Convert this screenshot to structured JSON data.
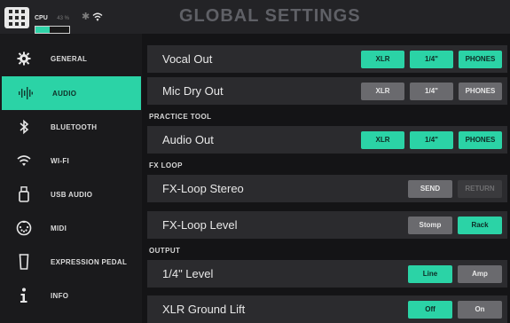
{
  "header": {
    "title": "GLOBAL SETTINGS",
    "cpu_label": "CPU",
    "cpu_percent_text": "43 %",
    "cpu_load": 0.43,
    "bluetooth_glyph": "✱",
    "icons": [
      "apps-grid-icon",
      "bluetooth-icon",
      "wifi-icon"
    ]
  },
  "sidebar": {
    "items": [
      {
        "label": "GENERAL",
        "icon": "gear-icon"
      },
      {
        "label": "AUDIO",
        "icon": "waveform-icon",
        "active": true
      },
      {
        "label": "BLUETOOTH",
        "icon": "bluetooth-icon"
      },
      {
        "label": "WI-FI",
        "icon": "wifi-icon"
      },
      {
        "label": "USB AUDIO",
        "icon": "usb-icon"
      },
      {
        "label": "MIDI",
        "icon": "midi-icon"
      },
      {
        "label": "EXPRESSION PEDAL",
        "icon": "pedal-icon"
      },
      {
        "label": "INFO",
        "icon": "info-icon"
      }
    ]
  },
  "main": {
    "sections": {
      "practice_tool": "PRACTICE TOOL",
      "fx_loop": "FX LOOP",
      "output": "OUTPUT"
    },
    "rows": {
      "vocal_out": {
        "label": "Vocal Out",
        "options": [
          "XLR",
          "1/4\"",
          "PHONES"
        ],
        "states": [
          "on",
          "on",
          "on"
        ]
      },
      "mic_dry_out": {
        "label": "Mic Dry Out",
        "options": [
          "XLR",
          "1/4\"",
          "PHONES"
        ],
        "states": [
          "off",
          "off",
          "off"
        ]
      },
      "audio_out": {
        "label": "Audio Out",
        "options": [
          "XLR",
          "1/4\"",
          "PHONES"
        ],
        "states": [
          "on",
          "on",
          "on"
        ]
      },
      "fx_loop_stereo": {
        "label": "FX-Loop Stereo",
        "options": [
          "SEND",
          "RETURN"
        ],
        "states": [
          "off",
          "dim"
        ]
      },
      "fx_loop_level": {
        "label": "FX-Loop Level",
        "options": [
          "Stomp",
          "Rack"
        ],
        "states": [
          "off",
          "on"
        ]
      },
      "quarter_level": {
        "label": "1/4\" Level",
        "options": [
          "Line",
          "Amp"
        ],
        "states": [
          "on",
          "off"
        ]
      },
      "xlr_ground_lift": {
        "label": "XLR Ground Lift",
        "options": [
          "Off",
          "On"
        ],
        "states": [
          "on",
          "off"
        ]
      }
    }
  },
  "colors": {
    "accent": "#2bd3a6",
    "button_off": "#6a6a6e",
    "button_dim": "#3a3a3d",
    "row_bg": "#2b2b2e",
    "sidebar_bg": "#1a1a1c",
    "title_gray": "#5f6066"
  }
}
